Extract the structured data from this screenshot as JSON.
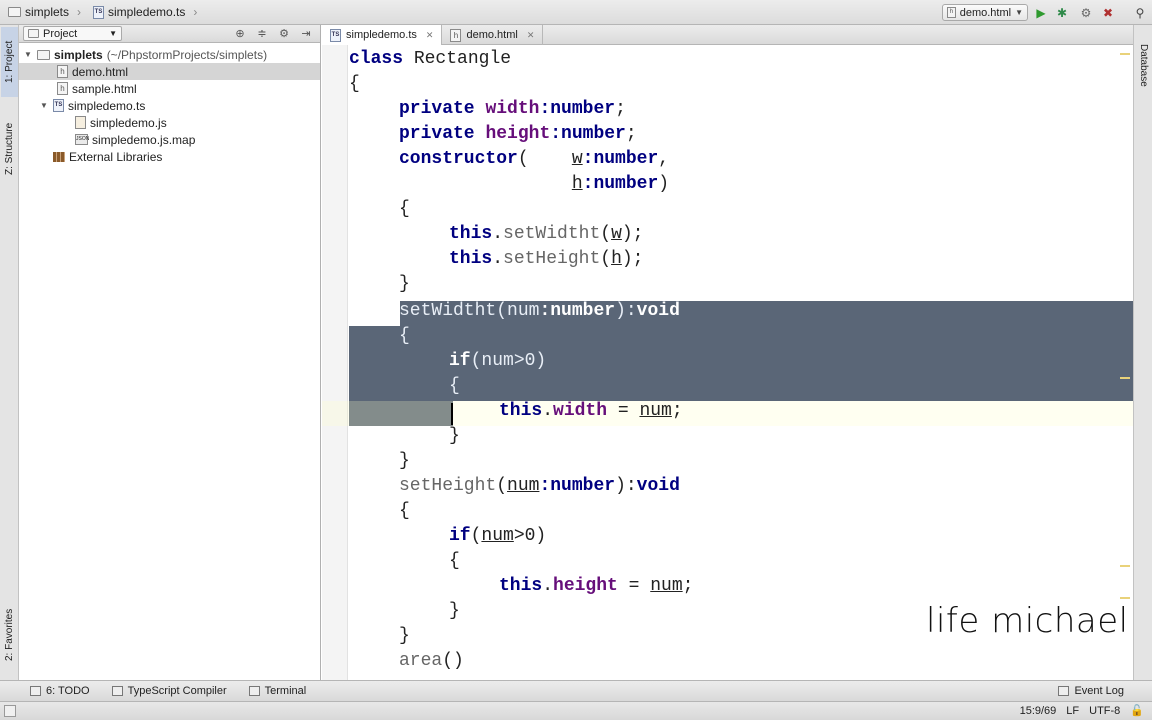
{
  "navbar": {
    "breadcrumbs": [
      {
        "label": "simplets",
        "icon": "folder-icon"
      },
      {
        "label": "simpledemo.ts",
        "icon": "typescript-file-icon"
      }
    ],
    "run_config": {
      "label": "demo.html",
      "icon": "html-file-icon"
    },
    "buttons": [
      "run-icon",
      "debug-icon",
      "settings-icon",
      "sdk-icon",
      "help-icon",
      "search-icon"
    ]
  },
  "left_strip": {
    "tabs": [
      {
        "label": "1: Project",
        "active": true
      },
      {
        "label": "Z: Structure",
        "active": false
      },
      {
        "label": "2: Favorites",
        "active": false
      }
    ]
  },
  "right_strip": {
    "tabs": [
      {
        "label": "Database"
      }
    ]
  },
  "project": {
    "view_label": "Project",
    "tree": [
      {
        "label": "simplets",
        "suffix": "(~/PhpstormProjects/simplets)",
        "type": "folder",
        "level": 0,
        "expanded": true,
        "selected": false
      },
      {
        "label": "demo.html",
        "type": "html",
        "level": 1,
        "selected": true
      },
      {
        "label": "sample.html",
        "type": "html",
        "level": 1,
        "selected": false
      },
      {
        "label": "simpledemo.ts",
        "type": "ts",
        "level": 1,
        "expanded": true,
        "selected": false
      },
      {
        "label": "simpledemo.js",
        "type": "js",
        "level": 2,
        "selected": false
      },
      {
        "label": "simpledemo.js.map",
        "type": "json",
        "level": 2,
        "selected": false
      },
      {
        "label": "External Libraries",
        "type": "library",
        "level": 0,
        "selected": false
      }
    ]
  },
  "editor": {
    "tabs": [
      {
        "label": "simpledemo.ts",
        "active": true
      },
      {
        "label": "demo.html",
        "active": false
      }
    ],
    "code_lines": [
      "class Rectangle",
      "{",
      "    private width:number;",
      "    private height:number;",
      "    constructor(    w:number,",
      "                    h:number)",
      "    {",
      "        this.setWidtht(w);",
      "        this.setHeight(h);",
      "    }",
      "    setWidtht(num:number):void",
      "    {",
      "        if(num>0)",
      "        {",
      "            this.width = num;",
      "        }",
      "    }",
      "    setHeight(num:number):void",
      "    {",
      "        if(num>0)",
      "        {",
      "            this.height = num;",
      "        }",
      "    }",
      "    area()"
    ],
    "watermark": "life michael"
  },
  "bottom_toolbar": {
    "todo": "6: TODO",
    "compiler": "TypeScript Compiler",
    "terminal": "Terminal",
    "event_log": "Event Log"
  },
  "status_bar": {
    "position": "15:9/69",
    "line_ending": "LF",
    "encoding": "UTF-8"
  }
}
